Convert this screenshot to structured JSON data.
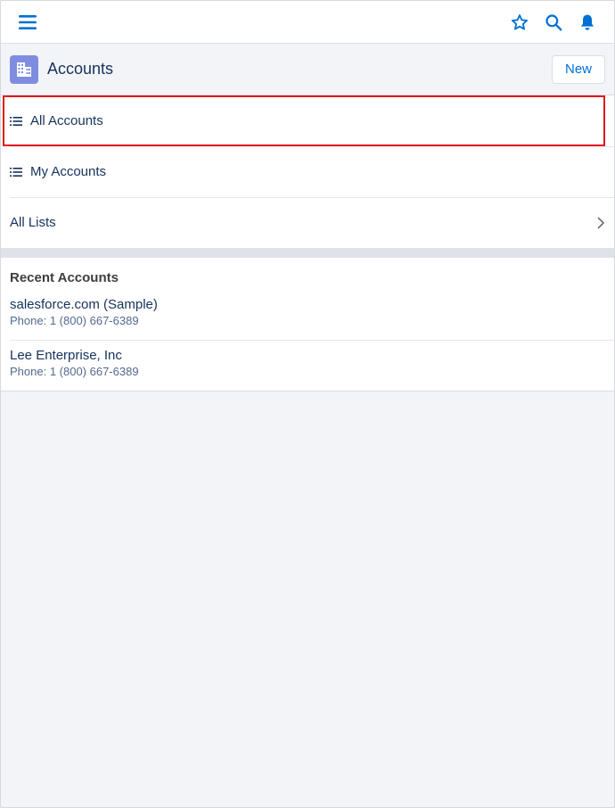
{
  "topbar": {
    "menu_icon": "hamburger-icon",
    "favorites_icon": "star-icon",
    "search_icon": "search-icon",
    "notifications_icon": "bell-icon",
    "accent": "#0070d2"
  },
  "header": {
    "title": "Accounts",
    "object_icon": "building-icon",
    "object_icon_color": "#7f8de1",
    "new_label": "New"
  },
  "list_views": [
    {
      "label": "All Accounts",
      "icon": "list-icon",
      "highlighted": true
    },
    {
      "label": "My Accounts",
      "icon": "list-icon",
      "highlighted": false
    }
  ],
  "all_lists": {
    "label": "All Lists",
    "icon": "chevron-right-icon"
  },
  "recent": {
    "title": "Recent Accounts",
    "items": [
      {
        "name": "salesforce.com (Sample)",
        "phone": "Phone: 1 (800) 667-6389"
      },
      {
        "name": "Lee Enterprise, Inc",
        "phone": "Phone: 1 (800) 667-6389"
      }
    ]
  },
  "highlight_color": "#e0191f"
}
